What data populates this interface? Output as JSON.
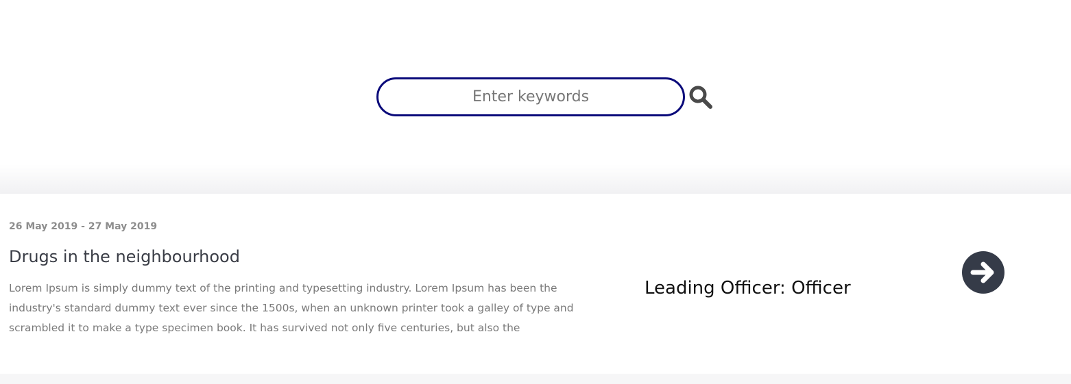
{
  "search": {
    "placeholder": "Enter keywords",
    "value": "",
    "border_color": "#0a0a7a",
    "icon": "search-icon"
  },
  "event": {
    "date_range": "26 May 2019 - 27 May 2019",
    "title": "Drugs in the neighbourhood",
    "description": "Lorem Ipsum is simply dummy text of the printing and typesetting industry. Lorem Ipsum has been the industry's standard dummy text ever since the 1500s, when an unknown printer took a galley of type and scrambled it to make a type specimen book. It has survived not only five centuries, but also the",
    "officer": "Leading Officer: Officer",
    "action_icon": "arrow-right-circle-icon",
    "action_color": "#353b48"
  }
}
